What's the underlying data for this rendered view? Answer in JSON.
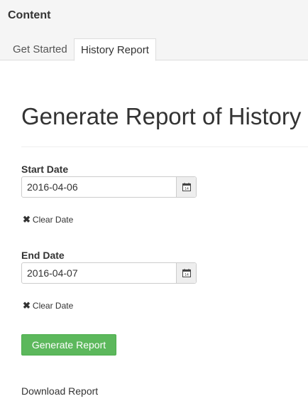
{
  "header": {
    "title": "Content",
    "tabs": [
      {
        "label": "Get Started",
        "active": false
      },
      {
        "label": "History Report",
        "active": true
      }
    ]
  },
  "main": {
    "title": "Generate Report of History",
    "start_date": {
      "label": "Start Date",
      "value": "2016-04-06",
      "clear_label": "Clear Date",
      "calendar_icon": "calendar-icon"
    },
    "end_date": {
      "label": "End Date",
      "value": "2016-04-07",
      "clear_label": "Clear Date",
      "calendar_icon": "calendar-icon"
    },
    "generate_label": "Generate Report",
    "download_label": "Download Report"
  },
  "colors": {
    "accent_green": "#5cb85c",
    "tabbar_bg": "#f5f5f5"
  }
}
